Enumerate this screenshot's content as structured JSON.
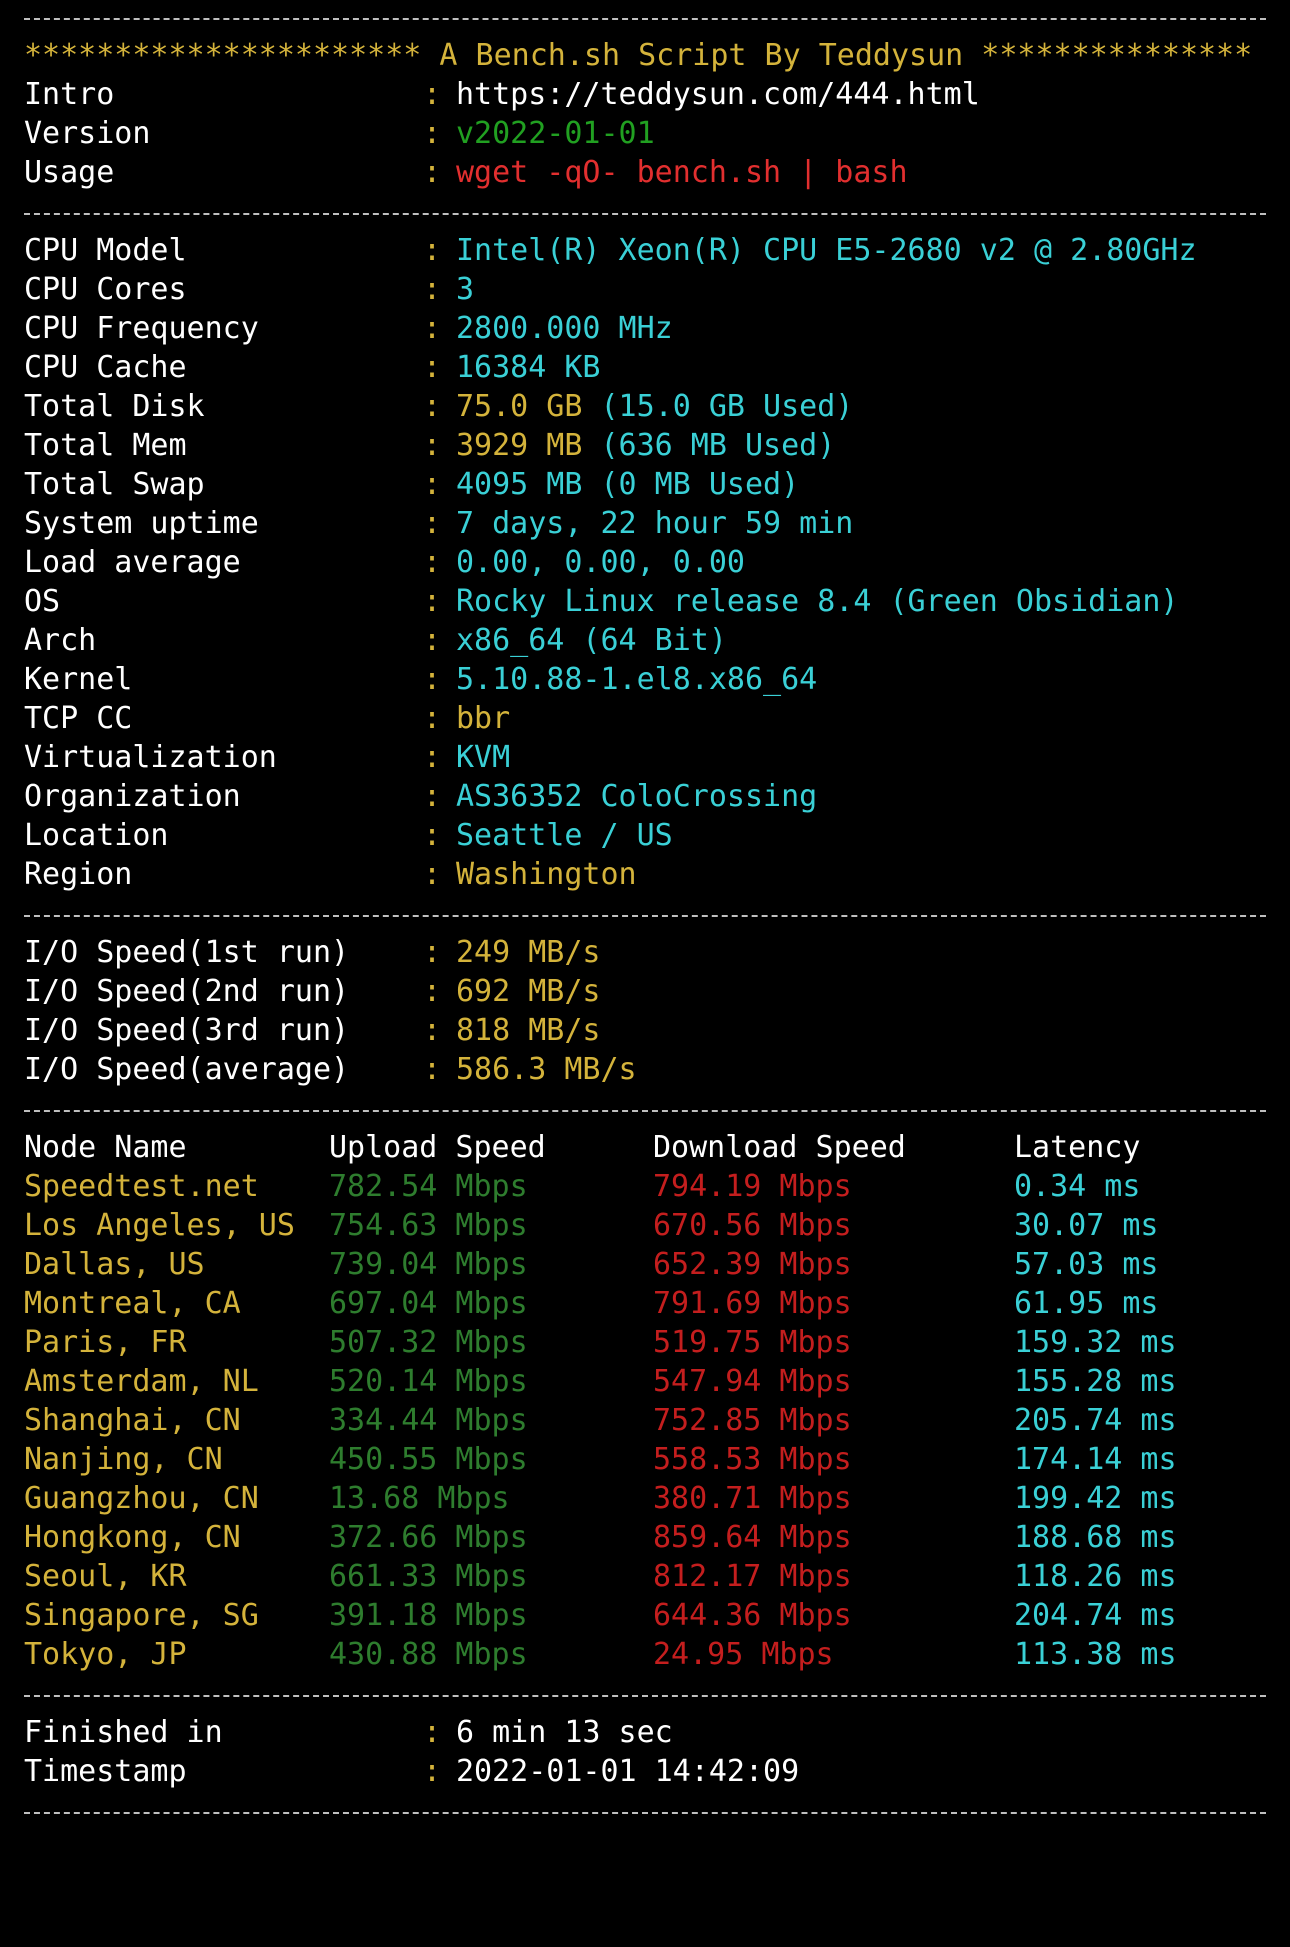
{
  "separator": "------------------------------------------------------------------------------------",
  "header": {
    "banner": "********************** A Bench.sh Script By Teddysun ***************"
  },
  "intro": [
    {
      "key": "Intro",
      "value": "https://teddysun.com/444.html"
    },
    {
      "key": "Version",
      "value": "v2022-01-01"
    },
    {
      "key": "Usage",
      "value": "wget -qO- bench.sh | bash"
    }
  ],
  "system": [
    {
      "key": "CPU Model",
      "value": "Intel(R) Xeon(R) CPU E5-2680 v2 @ 2.80GHz"
    },
    {
      "key": "CPU Cores",
      "value": "3"
    },
    {
      "key": "CPU Frequency",
      "value": "2800.000 MHz"
    },
    {
      "key": "CPU Cache",
      "value": "16384 KB"
    },
    {
      "key": "Total Disk",
      "value": "75.0 GB",
      "extra": "(15.0 GB Used)"
    },
    {
      "key": "Total Mem",
      "value": "3929 MB",
      "extra": "(636 MB Used)"
    },
    {
      "key": "Total Swap",
      "value": "4095 MB (0 MB Used)"
    },
    {
      "key": "System uptime",
      "value": "7 days, 22 hour 59 min"
    },
    {
      "key": "Load average",
      "value": "0.00, 0.00, 0.00"
    },
    {
      "key": "OS",
      "value": "Rocky Linux release 8.4 (Green Obsidian)"
    },
    {
      "key": "Arch",
      "value": "x86_64 (64 Bit)"
    },
    {
      "key": "Kernel",
      "value": "5.10.88-1.el8.x86_64"
    },
    {
      "key": "TCP CC",
      "value": "bbr"
    },
    {
      "key": "Virtualization",
      "value": "KVM"
    },
    {
      "key": "Organization",
      "value": "AS36352 ColoCrossing"
    },
    {
      "key": "Location",
      "value": "Seattle / US"
    },
    {
      "key": "Region",
      "value": "Washington"
    }
  ],
  "io": [
    {
      "key": "I/O Speed(1st run)",
      "value": "249 MB/s"
    },
    {
      "key": "I/O Speed(2nd run)",
      "value": "692 MB/s"
    },
    {
      "key": "I/O Speed(3rd run)",
      "value": "818 MB/s"
    },
    {
      "key": "I/O Speed(average)",
      "value": "586.3 MB/s"
    }
  ],
  "speedtest": {
    "headers": {
      "node": "Node Name",
      "upload": "Upload Speed",
      "download": "Download Speed",
      "latency": "Latency"
    },
    "rows": [
      {
        "node": "Speedtest.net",
        "upload": "782.54 Mbps",
        "download": "794.19 Mbps",
        "latency": "0.34 ms"
      },
      {
        "node": "Los Angeles, US",
        "upload": "754.63 Mbps",
        "download": "670.56 Mbps",
        "latency": "30.07 ms"
      },
      {
        "node": "Dallas, US",
        "upload": "739.04 Mbps",
        "download": "652.39 Mbps",
        "latency": "57.03 ms"
      },
      {
        "node": "Montreal, CA",
        "upload": "697.04 Mbps",
        "download": "791.69 Mbps",
        "latency": "61.95 ms"
      },
      {
        "node": "Paris, FR",
        "upload": "507.32 Mbps",
        "download": "519.75 Mbps",
        "latency": "159.32 ms"
      },
      {
        "node": "Amsterdam, NL",
        "upload": "520.14 Mbps",
        "download": "547.94 Mbps",
        "latency": "155.28 ms"
      },
      {
        "node": "Shanghai, CN",
        "upload": "334.44 Mbps",
        "download": "752.85 Mbps",
        "latency": "205.74 ms"
      },
      {
        "node": "Nanjing, CN",
        "upload": "450.55 Mbps",
        "download": "558.53 Mbps",
        "latency": "174.14 ms"
      },
      {
        "node": "Guangzhou, CN",
        "upload": "13.68 Mbps",
        "download": "380.71 Mbps",
        "latency": "199.42 ms"
      },
      {
        "node": "Hongkong, CN",
        "upload": "372.66 Mbps",
        "download": "859.64 Mbps",
        "latency": "188.68 ms"
      },
      {
        "node": "Seoul, KR",
        "upload": "661.33 Mbps",
        "download": "812.17 Mbps",
        "latency": "118.26 ms"
      },
      {
        "node": "Singapore, SG",
        "upload": "391.18 Mbps",
        "download": "644.36 Mbps",
        "latency": "204.74 ms"
      },
      {
        "node": "Tokyo, JP",
        "upload": "430.88 Mbps",
        "download": "24.95 Mbps",
        "latency": "113.38 ms"
      }
    ]
  },
  "footer": [
    {
      "key": "Finished in",
      "value": "6 min 13 sec"
    },
    {
      "key": "Timestamp",
      "value": "2022-01-01 14:42:09"
    }
  ],
  "colors": {
    "background": "#000000",
    "label": "#ffffff",
    "yellow": "#d4b33b",
    "cyan": "#3ad0d6",
    "green": "#21a021",
    "red": "#e22f2f"
  }
}
